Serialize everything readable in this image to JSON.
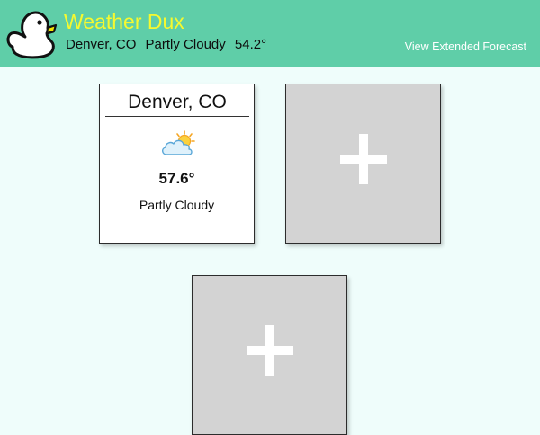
{
  "header": {
    "app_title": "Weather Dux",
    "logo_icon": "duck-icon",
    "current": {
      "city": "Denver, CO",
      "condition": "Partly Cloudy",
      "temperature": "54.2°"
    },
    "extended_link": "View Extended Forecast",
    "background_color": "#5fcea8",
    "title_color": "#f6f92f"
  },
  "cards": [
    {
      "city": "Denver, CO",
      "icon": "partly-cloudy-icon",
      "temperature": "57.6°",
      "condition": "Partly Cloudy"
    }
  ],
  "add_cards": [
    {
      "icon": "plus-icon"
    },
    {
      "icon": "plus-icon"
    }
  ],
  "colors": {
    "page_background": "#effdfb",
    "add_card_background": "#d3d3d3"
  }
}
